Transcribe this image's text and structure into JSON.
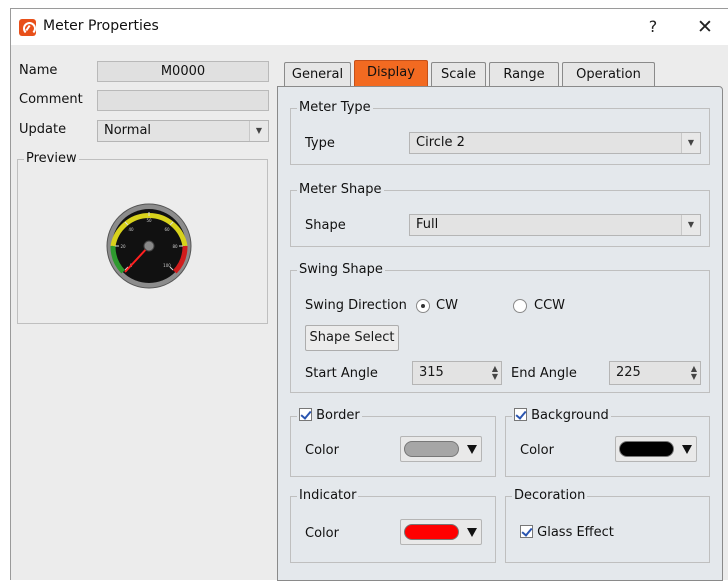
{
  "window": {
    "title": "Meter Properties",
    "help": "?",
    "close": "✕"
  },
  "left": {
    "name_label": "Name",
    "name_value": "M0000",
    "comment_label": "Comment",
    "comment_value": "",
    "update_label": "Update",
    "update_value": "Normal",
    "preview_label": "Preview"
  },
  "tabs": [
    "General",
    "Display",
    "Scale",
    "Range",
    "Operation"
  ],
  "active_tab": "Display",
  "display": {
    "meter_type": {
      "group": "Meter Type",
      "label": "Type",
      "value": "Circle 2"
    },
    "meter_shape": {
      "group": "Meter Shape",
      "label": "Shape",
      "value": "Full"
    },
    "swing": {
      "group": "Swing Shape",
      "direction_label": "Swing Direction",
      "cw": "CW",
      "ccw": "CCW",
      "selected": "CW",
      "shape_select": "Shape Select",
      "start_label": "Start Angle",
      "start_value": "315",
      "end_label": "End Angle",
      "end_value": "225"
    },
    "border": {
      "group": "Border",
      "checked": true,
      "color_label": "Color",
      "color": "#a6a6a6"
    },
    "background": {
      "group": "Background",
      "checked": true,
      "color_label": "Color",
      "color": "#000000"
    },
    "indicator": {
      "group": "Indicator",
      "color_label": "Color",
      "color": "#ff0000"
    },
    "decoration": {
      "group": "Decoration",
      "glass_label": "Glass Effect",
      "glass_checked": true
    }
  },
  "colors": {
    "accent_tab": "#f26a21",
    "gauge_green": "#2e9a2e",
    "gauge_yellow": "#d8d21c",
    "gauge_red": "#d01c1c"
  }
}
